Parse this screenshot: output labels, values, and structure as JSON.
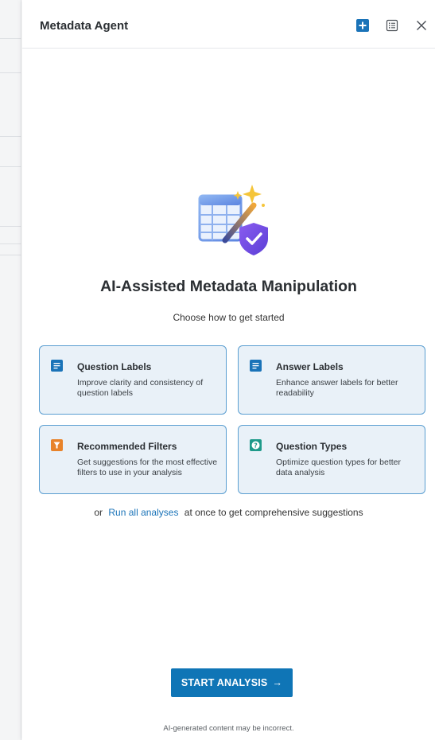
{
  "header": {
    "title": "Metadata Agent"
  },
  "hero": {
    "title": "AI-Assisted Metadata Manipulation",
    "subtitle": "Choose how to get started"
  },
  "cards": [
    {
      "icon": "document-lines-icon",
      "icon_color": "#1a73b8",
      "title": "Question Labels",
      "description": "Improve clarity and consistency of question labels"
    },
    {
      "icon": "document-lines-icon",
      "icon_color": "#1a73b8",
      "title": "Answer Labels",
      "description": "Enhance answer labels for better readability"
    },
    {
      "icon": "filter-icon",
      "icon_color": "#e8832a",
      "title": "Recommended Filters",
      "description": "Get suggestions for the most effective filters to use in your analysis"
    },
    {
      "icon": "question-mark-icon",
      "icon_color": "#1f9a8a",
      "title": "Question Types",
      "description": "Optimize question types for better data analysis"
    }
  ],
  "run_all": {
    "prefix": "or",
    "link": "Run all analyses",
    "suffix": "at once to get comprehensive suggestions"
  },
  "start_button": {
    "label": "START ANALYSIS",
    "arrow": "→"
  },
  "footer": {
    "disclaimer": "AI-generated content may be incorrect."
  },
  "colors": {
    "accent": "#0f75b6",
    "card_bg": "#e9f1f8",
    "card_border": "#5a9ed1"
  }
}
